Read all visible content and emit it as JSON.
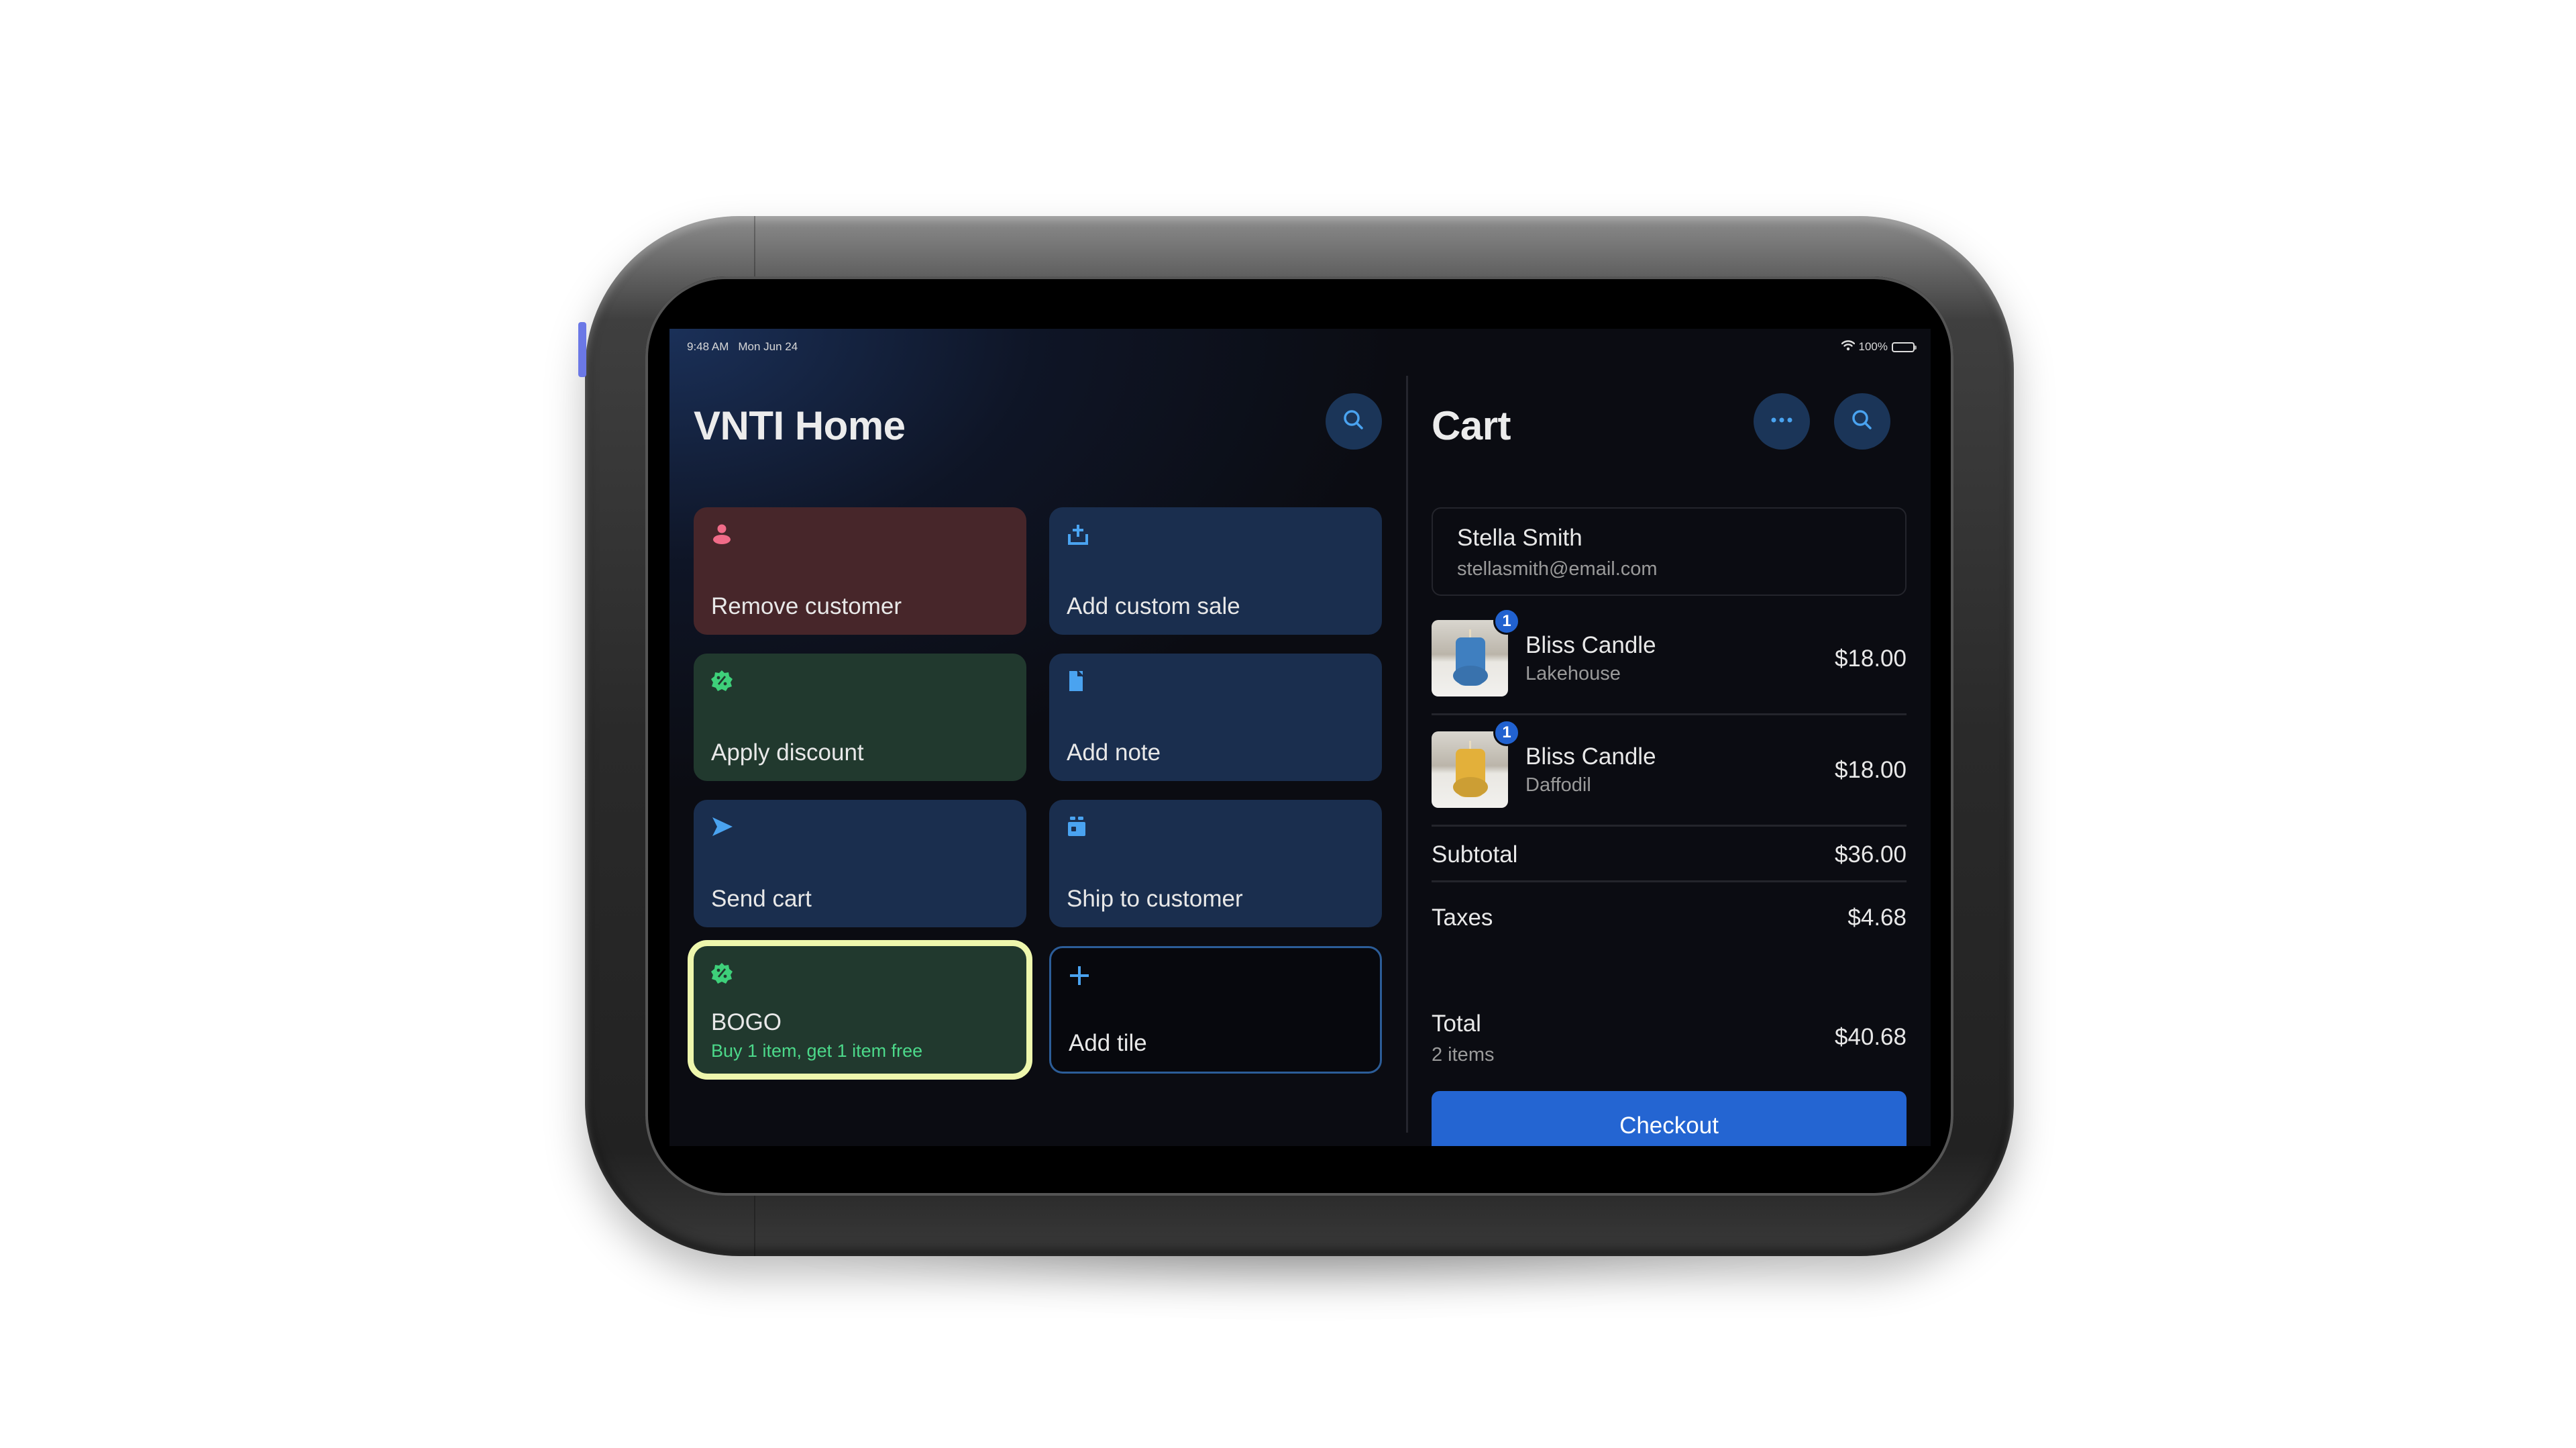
{
  "status_bar": {
    "time": "9:48 AM",
    "date": "Mon Jun 24",
    "battery_text": "100%",
    "battery_level": 1.0,
    "icons": [
      "wifi-icon",
      "battery-icon"
    ]
  },
  "home": {
    "title": "VNTI Home",
    "search_icon": "search-icon",
    "tiles": [
      {
        "label": "Remove customer",
        "icon": "person-icon",
        "style": "red",
        "icon_color": "#f06b88"
      },
      {
        "label": "Add custom sale",
        "icon": "tray-upload-icon",
        "style": "blue",
        "icon_color": "#4aa3f0"
      },
      {
        "label": "Apply discount",
        "icon": "discount-badge-icon",
        "style": "green",
        "icon_color": "#3ed07a"
      },
      {
        "label": "Add note",
        "icon": "document-icon",
        "style": "blue",
        "icon_color": "#4aa3f0"
      },
      {
        "label": "Send cart",
        "icon": "send-arrow-icon",
        "style": "blue",
        "icon_color": "#4aa3f0"
      },
      {
        "label": "Ship to customer",
        "icon": "shipping-box-icon",
        "style": "blue",
        "icon_color": "#4aa3f0"
      },
      {
        "label": "BOGO",
        "sublabel": "Buy 1 item, get 1 item free",
        "icon": "discount-badge-icon",
        "style": "green",
        "selected": true,
        "icon_color": "#3ed07a"
      },
      {
        "label": "Add tile",
        "icon": "plus-icon",
        "style": "outline",
        "icon_color": "#4aa3f0"
      }
    ]
  },
  "cart": {
    "title": "Cart",
    "more_icon": "ellipsis-icon",
    "search_icon": "search-icon",
    "customer": {
      "name": "Stella Smith",
      "email": "stellasmith@email.com"
    },
    "items": [
      {
        "name": "Bliss Candle",
        "variant": "Lakehouse",
        "price": "$18.00",
        "quantity": "1",
        "candle_color": "#3f7fc0"
      },
      {
        "name": "Bliss Candle",
        "variant": "Daffodil",
        "price": "$18.00",
        "quantity": "1",
        "candle_color": "#e3b03a"
      }
    ],
    "subtotal_label": "Subtotal",
    "subtotal_value": "$36.00",
    "taxes_label": "Taxes",
    "taxes_value": "$4.68",
    "total_label": "Total",
    "total_count": "2 items",
    "total_value": "$40.68",
    "checkout_label": "Checkout"
  },
  "colors": {
    "accent": "#2465d2",
    "selection_outline": "#eef7ad",
    "discount_green": "#4cd98a"
  }
}
